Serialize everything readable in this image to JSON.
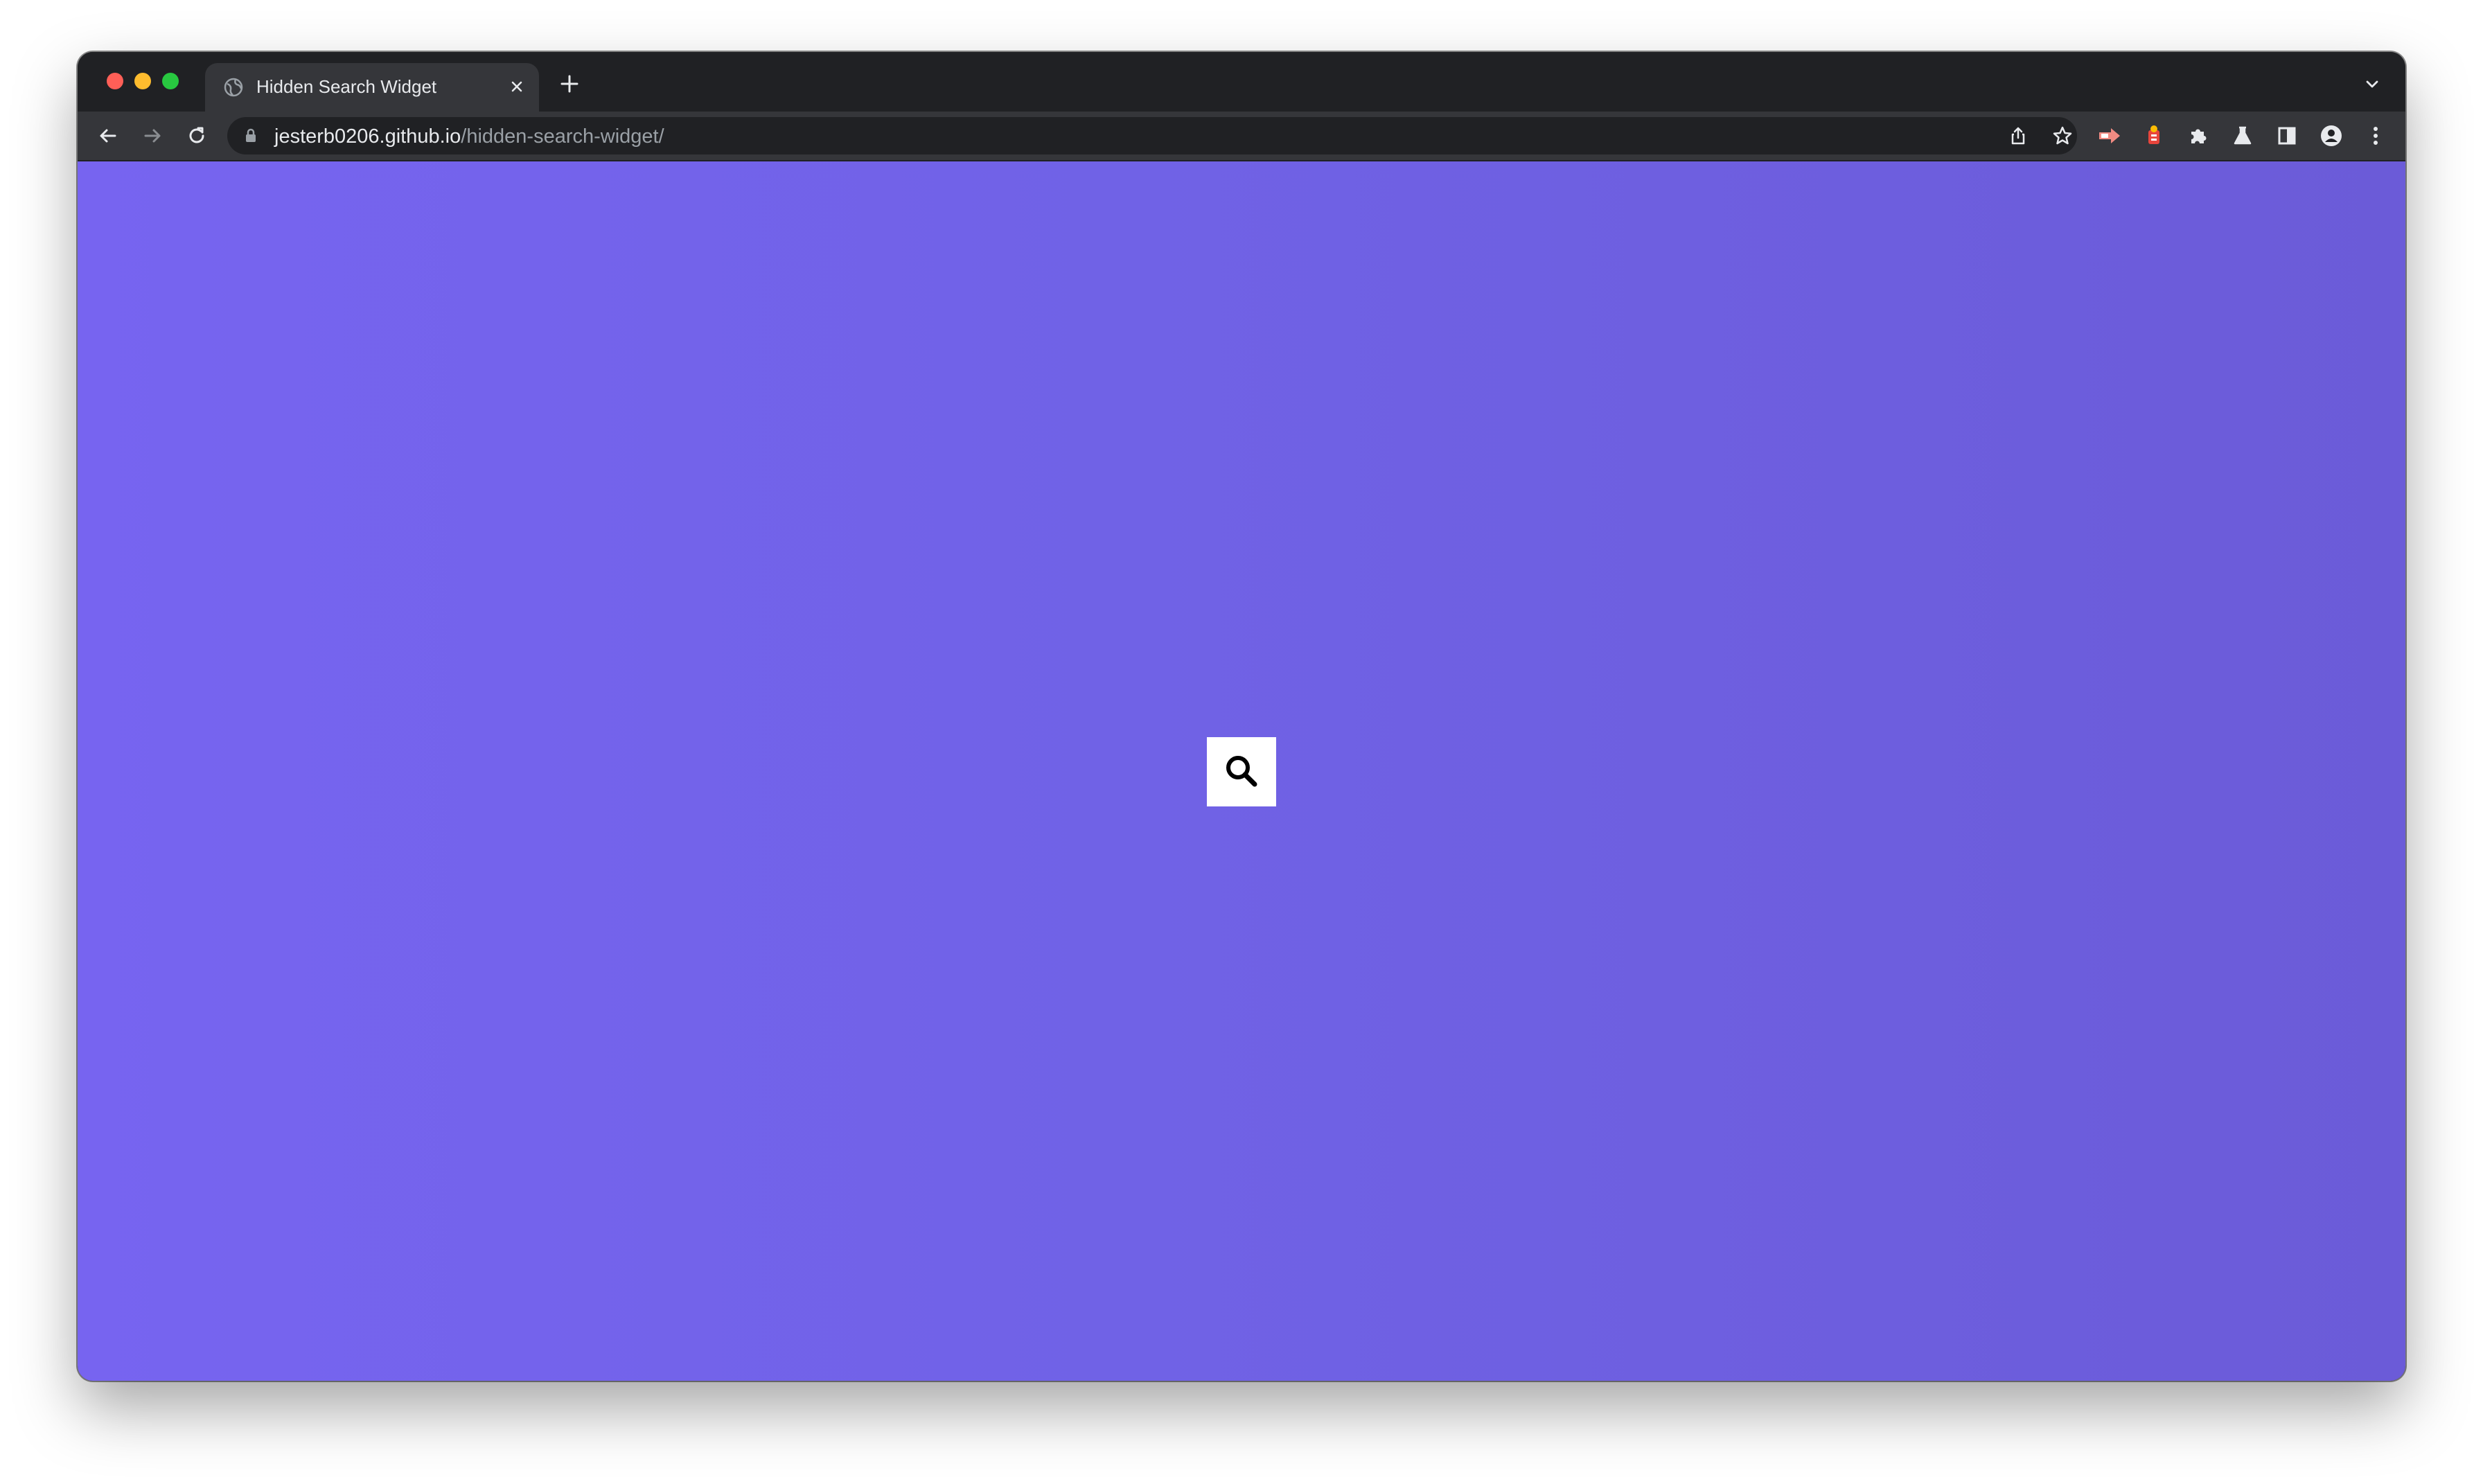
{
  "browser": {
    "tab": {
      "title": "Hidden Search Widget",
      "favicon": "globe-icon"
    },
    "address_bar": {
      "host": "jesterb0206.github.io",
      "path": "/hidden-search-widget/"
    },
    "toolbar_icons": [
      "back-arrow-icon",
      "forward-arrow-icon",
      "reload-icon",
      "share-icon",
      "bookmark-star-icon",
      "extension-icon",
      "extension-icon",
      "puzzle-icon",
      "labs-flask-icon",
      "side-panel-icon",
      "profile-icon",
      "menu-kebab-icon"
    ]
  },
  "page": {
    "background_colors": [
      "#7764f0",
      "#6b5bd8"
    ],
    "search_widget": {
      "icon": "search-icon",
      "background": "#ffffff"
    }
  }
}
